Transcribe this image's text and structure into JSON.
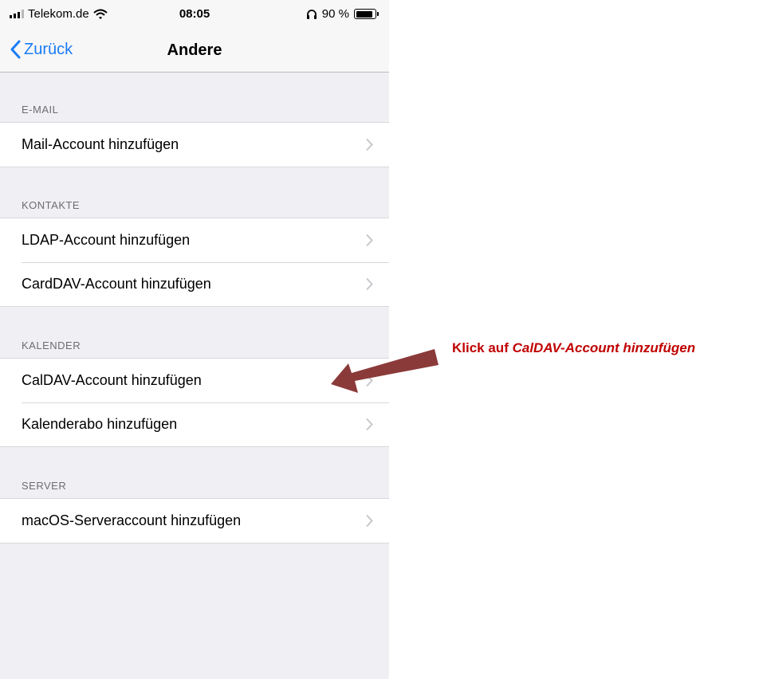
{
  "status_bar": {
    "carrier": "Telekom.de",
    "time": "08:05",
    "battery_text": "90 %"
  },
  "nav": {
    "back_label": "Zurück",
    "title": "Andere"
  },
  "sections": [
    {
      "header": "E-MAIL",
      "items": [
        {
          "label": "Mail-Account hinzufügen"
        }
      ]
    },
    {
      "header": "KONTAKTE",
      "items": [
        {
          "label": "LDAP-Account hinzufügen"
        },
        {
          "label": "CardDAV-Account hinzufügen"
        }
      ]
    },
    {
      "header": "KALENDER",
      "items": [
        {
          "label": "CalDAV-Account hinzufügen"
        },
        {
          "label": "Kalenderabo hinzufügen"
        }
      ]
    },
    {
      "header": "SERVER",
      "items": [
        {
          "label": "macOS-Serveraccount hinzufügen"
        }
      ]
    }
  ],
  "annotation": {
    "prefix": "Klick auf ",
    "target": "CalDAV-Account hinzufügen"
  },
  "colors": {
    "accent": "#1a7cf5",
    "annotation_text": "#c00000",
    "arrow": "#8b3a3a",
    "background": "#efeff4"
  },
  "icons": [
    "signal-icon",
    "wifi-icon",
    "headphones-icon",
    "battery-icon",
    "back-chevron-icon",
    "chevron-right-icon",
    "arrow-icon"
  ]
}
